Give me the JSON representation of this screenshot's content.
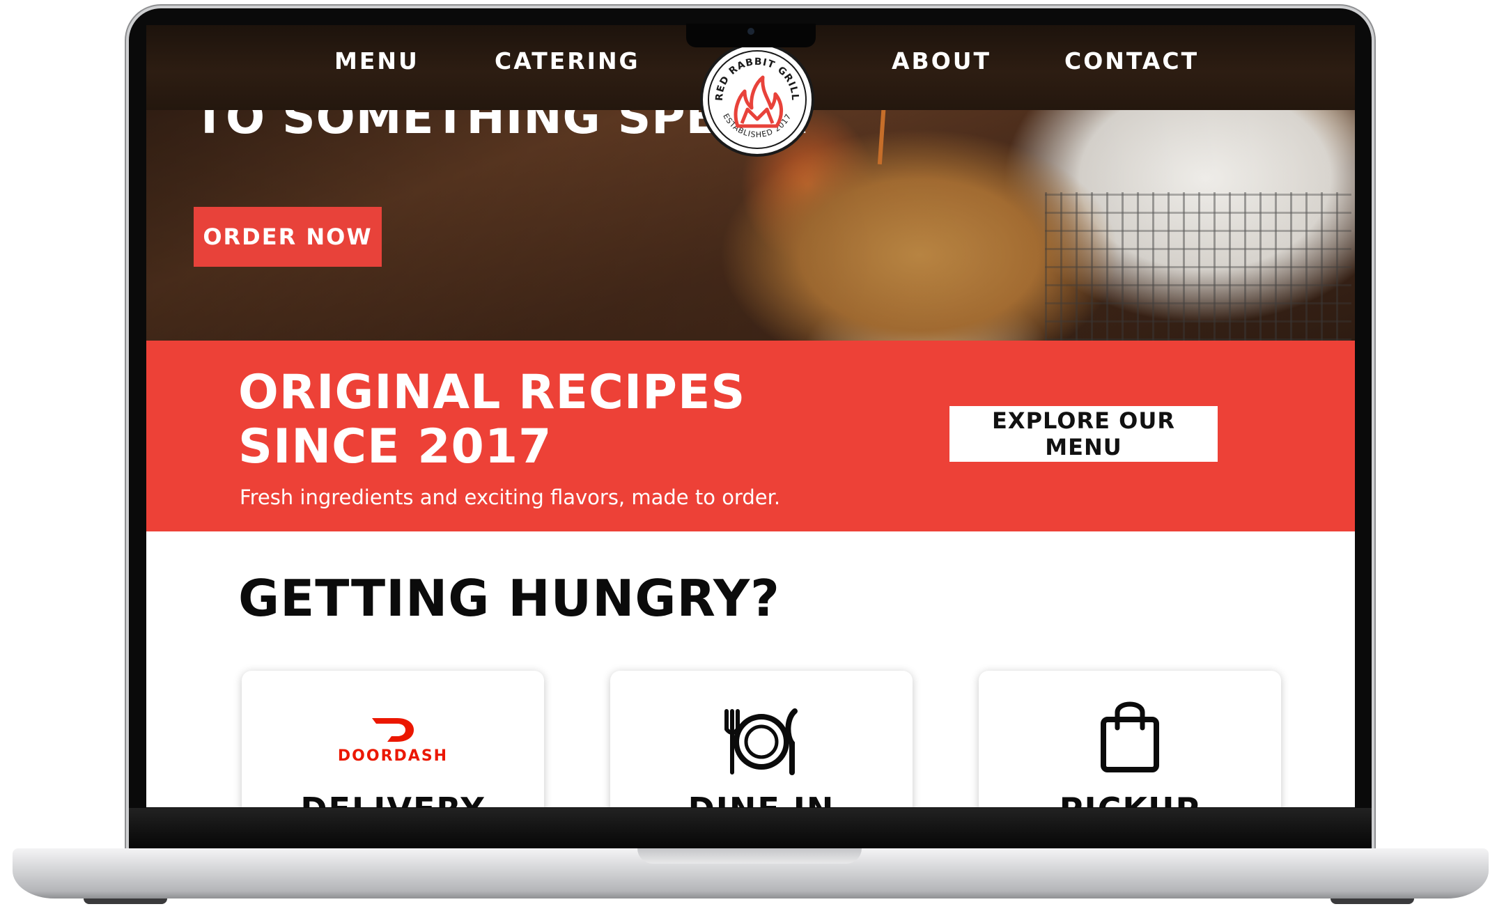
{
  "nav": {
    "items": [
      {
        "label": "MENU"
      },
      {
        "label": "CATERING"
      },
      {
        "label": "ABOUT"
      },
      {
        "label": "CONTACT"
      }
    ],
    "logo": {
      "name": "RED RABBIT GRILL",
      "tagline": "ESTABLISHED 2017"
    }
  },
  "hero": {
    "title": "TO SOMETHING SPECIA",
    "cta_label": "ORDER NOW"
  },
  "banner": {
    "title_line1": "ORIGINAL RECIPES",
    "title_line2": "SINCE 2017",
    "subtitle": "Fresh ingredients and exciting flavors, made to order.",
    "cta_label": "EXPLORE OUR MENU"
  },
  "hungry": {
    "title": "GETTING HUNGRY?",
    "cards": [
      {
        "label": "DELIVERY",
        "brand": "DOORDASH",
        "icon": "doordash-icon"
      },
      {
        "label": "DINE IN",
        "icon": "plate-utensils-icon"
      },
      {
        "label": "PICKUP",
        "icon": "shopping-bag-icon"
      }
    ]
  },
  "colors": {
    "accent": "#ed4137",
    "doordash": "#eb1700",
    "nav_bg": "#24170e",
    "text_dark": "#0b0b0b"
  }
}
